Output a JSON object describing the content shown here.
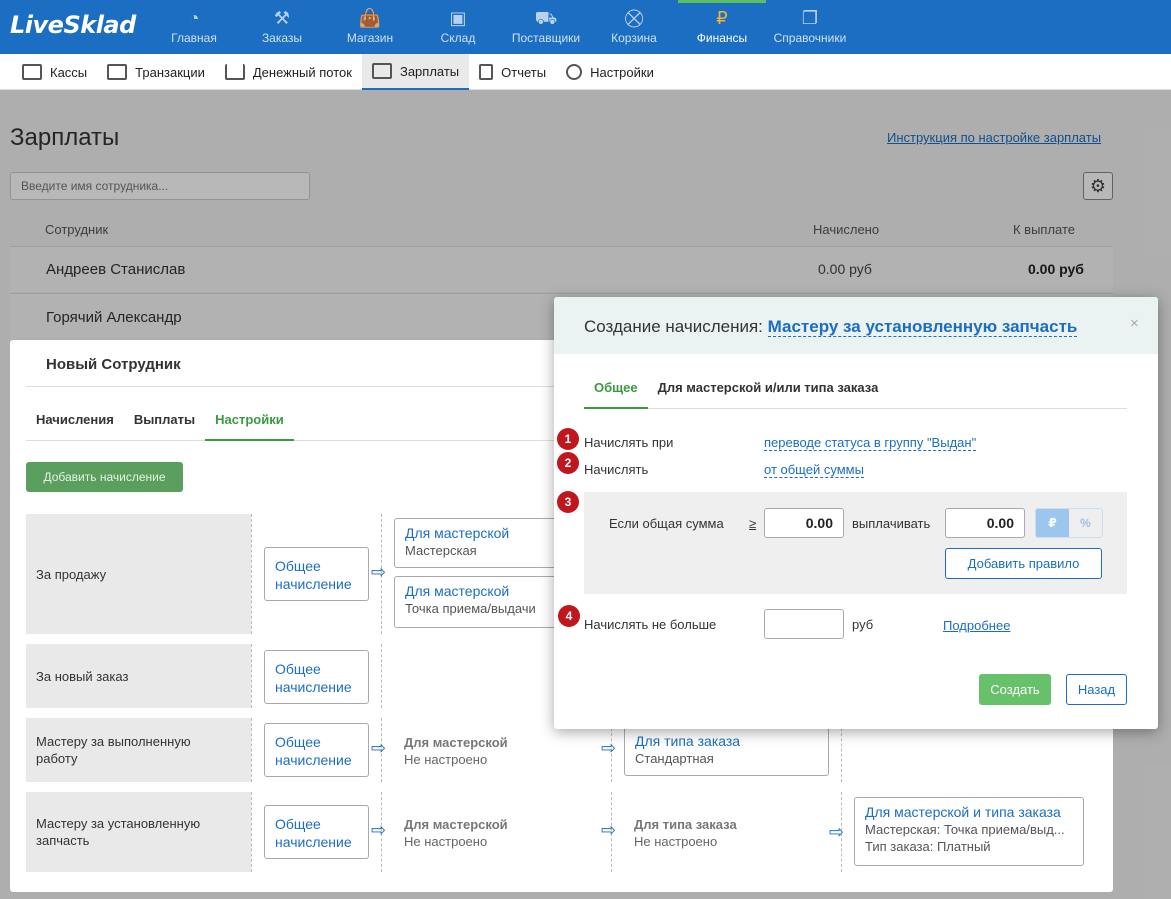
{
  "app": {
    "logo": "LiveSklad"
  },
  "topnav": [
    {
      "label": "Главная",
      "icon": "pie-chart-icon",
      "glyph": "◔"
    },
    {
      "label": "Заказы",
      "icon": "orders-icon",
      "glyph": "⚒"
    },
    {
      "label": "Магазин",
      "icon": "store-bag-icon",
      "glyph": "👜"
    },
    {
      "label": "Склад",
      "icon": "warehouse-box-icon",
      "glyph": "▣"
    },
    {
      "label": "Поставщики",
      "icon": "truck-icon",
      "glyph": "⛟"
    },
    {
      "label": "Корзина",
      "icon": "cart-icon",
      "glyph": "⛒"
    },
    {
      "label": "Финансы",
      "icon": "ruble-icon",
      "glyph": "₽"
    },
    {
      "label": "Справочники",
      "icon": "reference-books-icon",
      "glyph": "❐"
    }
  ],
  "subnav": [
    {
      "label": "Кассы",
      "icon": "cash-register-icon"
    },
    {
      "label": "Транзакции",
      "icon": "card-icon"
    },
    {
      "label": "Денежный поток",
      "icon": "bar-chart-icon"
    },
    {
      "label": "Зарплаты",
      "icon": "wallet-icon"
    },
    {
      "label": "Отчеты",
      "icon": "report-icon"
    },
    {
      "label": "Настройки",
      "icon": "gear-icon"
    }
  ],
  "page": {
    "title": "Зарплаты",
    "help_link": "Инструкция по настройке зарплаты",
    "search_placeholder": "Введите имя сотрудника...",
    "columns": {
      "employee": "Сотрудник",
      "accrued": "Начислено",
      "to_pay": "К выплате"
    },
    "employees": [
      {
        "name": "Андреев Станислав",
        "accrued": "0.00 руб",
        "to_pay": "0.00 руб"
      },
      {
        "name": "Горячий Александр",
        "accrued": "",
        "to_pay": ""
      }
    ]
  },
  "employee_modal": {
    "title": "Новый Сотрудник",
    "tabs": [
      "Начисления",
      "Выплаты",
      "Настройки"
    ],
    "add_button": "Добавить начисление",
    "rows": [
      {
        "label": "За продажу",
        "general": "Общее начисление",
        "cards": [
          {
            "title": "Для мастерской",
            "sub": "Мастерская"
          },
          {
            "title": "Для мастерской",
            "sub": "Точка приема/выдачи"
          }
        ]
      },
      {
        "label": "За новый заказ",
        "general": "Общее начисление"
      },
      {
        "label": "Мастеру за выполненную работу",
        "general": "Общее начисление",
        "col2": {
          "title": "Для мастерской",
          "sub": "Не настроено"
        },
        "col3": {
          "title": "Для типа заказа",
          "sub": "Стандартная"
        }
      },
      {
        "label": "Мастеру за установленную запчасть",
        "general": "Общее начисление",
        "col2": {
          "title": "Для мастерской",
          "sub": "Не настроено"
        },
        "col3": {
          "title": "Для типа заказа",
          "sub": "Не настроено"
        },
        "col4": {
          "title": "Для мастерской и типа заказа",
          "sub1": "Мастерская: Точка приема/выд...",
          "sub2": "Тип заказа: Платный"
        }
      }
    ]
  },
  "dialog": {
    "title_prefix": "Создание начисления:",
    "title_link": "Мастеру за установленную запчасть",
    "close": "×",
    "tabs": [
      "Общее",
      "Для мастерской и/или типа заказа"
    ],
    "field1_label": "Начислять при",
    "field1_value": "переводе статуса в группу \"Выдан\"",
    "field2_label": "Начислять",
    "field2_value": "от общей суммы",
    "rule_label": "Если общая сумма",
    "rule_operator": "≥",
    "rule_amount": "0.00",
    "rule_pay_label": "выплачивать",
    "rule_pay_amount": "0.00",
    "unit_options": [
      "₽",
      "%"
    ],
    "add_rule": "Добавить правило",
    "max_label": "Начислять не больше",
    "max_value": "",
    "max_unit": "руб",
    "more_link": "Подробнее",
    "create_btn": "Создать",
    "back_btn": "Назад",
    "badges": [
      "1",
      "2",
      "3",
      "4"
    ]
  }
}
